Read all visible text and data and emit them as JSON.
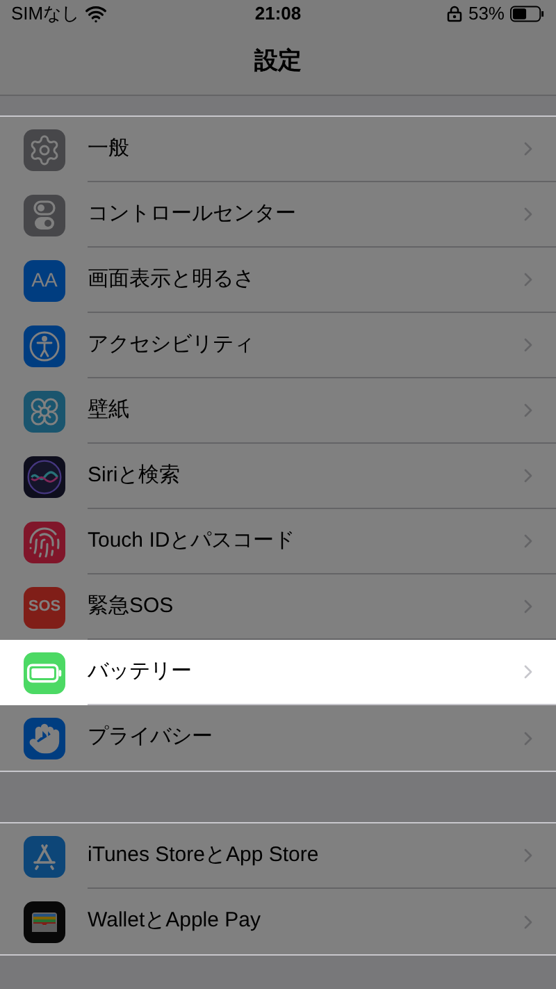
{
  "status_bar": {
    "carrier": "SIMなし",
    "time": "21:08",
    "battery": "53%"
  },
  "nav": {
    "title": "設定"
  },
  "groups": [
    {
      "items": [
        {
          "label": "一般",
          "highlighted": false
        },
        {
          "label": "コントロールセンター",
          "highlighted": false
        },
        {
          "label": "画面表示と明るさ",
          "icon_text": "AA",
          "highlighted": false
        },
        {
          "label": "アクセシビリティ",
          "highlighted": false
        },
        {
          "label": "壁紙",
          "highlighted": false
        },
        {
          "label": "Siriと検索",
          "highlighted": false
        },
        {
          "label": "Touch IDとパスコード",
          "highlighted": false
        },
        {
          "label": "緊急SOS",
          "icon_text": "SOS",
          "highlighted": false
        },
        {
          "label": "バッテリー",
          "highlighted": true
        },
        {
          "label": "プライバシー",
          "highlighted": false
        }
      ]
    },
    {
      "items": [
        {
          "label": "iTunes StoreとApp Store",
          "highlighted": false
        },
        {
          "label": "WalletとApple Pay",
          "highlighted": false
        }
      ]
    }
  ]
}
